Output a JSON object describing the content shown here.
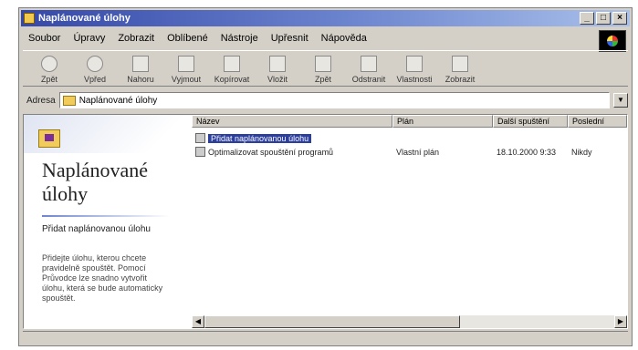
{
  "window": {
    "title": "Naplánované úlohy",
    "min": "_",
    "max": "□",
    "close": "×"
  },
  "menu": [
    "Soubor",
    "Úpravy",
    "Zobrazit",
    "Oblíbené",
    "Nástroje",
    "Upřesnit",
    "Nápověda"
  ],
  "toolbar": {
    "buttons": [
      {
        "label": "Zpět",
        "icon": "back-icon"
      },
      {
        "label": "Vpřed",
        "icon": "forward-icon"
      },
      {
        "label": "Nahoru",
        "icon": "up-icon"
      },
      {
        "label": "Vyjmout",
        "icon": "cut-icon"
      },
      {
        "label": "Kopírovat",
        "icon": "copy-icon"
      },
      {
        "label": "Vložit",
        "icon": "paste-icon"
      },
      {
        "label": "Zpět",
        "icon": "undo-icon"
      },
      {
        "label": "Odstranit",
        "icon": "delete-icon"
      },
      {
        "label": "Vlastnosti",
        "icon": "properties-icon"
      },
      {
        "label": "Zobrazit",
        "icon": "views-icon"
      }
    ]
  },
  "address": {
    "label": "Adresa",
    "value": "Naplánované úlohy"
  },
  "leftpane": {
    "heading": "Naplánované úlohy",
    "subheading": "Přidat naplánovanou úlohu",
    "description": "Přidejte úlohu, kterou chcete pravidelně spouštět. Pomocí Průvodce lze snadno vytvořit úlohu, která se bude automaticky spouštět."
  },
  "columns": {
    "name": "Název",
    "kind": "Plán",
    "date": "Další spuštění",
    "size": "Poslední"
  },
  "files": [
    {
      "name": "Přidat naplánovanou úlohu",
      "kind": "",
      "date": "",
      "size": "",
      "selected": true
    },
    {
      "name": "Optimalizovat spouštění programů",
      "kind": "Vlastní plán",
      "date": "18.10.2000 9:33",
      "size": "Nikdy",
      "selected": false
    }
  ]
}
